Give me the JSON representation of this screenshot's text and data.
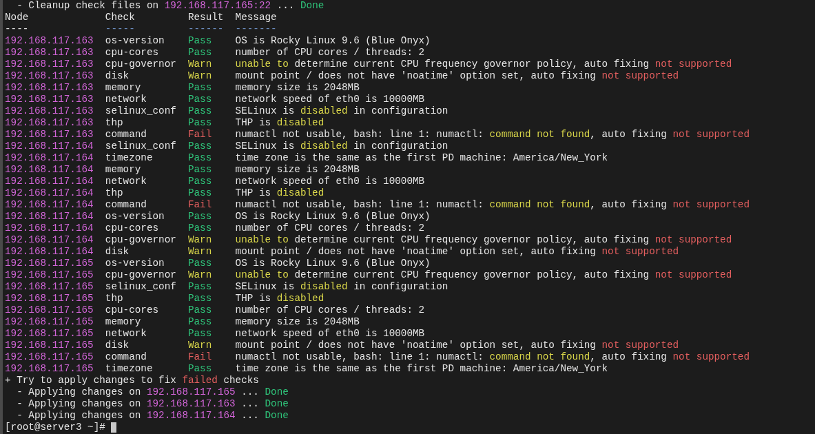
{
  "top_line": [
    {
      "text": "  - Cleanup check files on ",
      "kind": "plain"
    },
    {
      "text": "192.168.117.165:22",
      "kind": "host"
    },
    {
      "text": " ... ",
      "kind": "plain"
    },
    {
      "text": "Done",
      "kind": "ok"
    }
  ],
  "columns": [
    "Node",
    "Check",
    "Result",
    "Message"
  ],
  "column_rules": [
    {
      "text": "----",
      "kind": "plain"
    },
    {
      "text": "-----",
      "kind": "rule"
    },
    {
      "text": "------",
      "kind": "rule"
    },
    {
      "text": "-------",
      "kind": "rule"
    }
  ],
  "rows": [
    {
      "node": "192.168.117.163",
      "check": "os-version",
      "result": "Pass",
      "kind": "pass",
      "message": [
        {
          "text": "OS is Rocky Linux 9.6 (Blue Onyx)",
          "kind": "plain"
        }
      ]
    },
    {
      "node": "192.168.117.163",
      "check": "cpu-cores",
      "result": "Pass",
      "kind": "pass",
      "message": [
        {
          "text": "number of CPU cores / threads: 2",
          "kind": "plain"
        }
      ]
    },
    {
      "node": "192.168.117.163",
      "check": "cpu-governor",
      "result": "Warn",
      "kind": "warn",
      "message": [
        {
          "text": "unable to",
          "kind": "warn"
        },
        {
          "text": " determine current CPU frequency governor policy, auto fixing ",
          "kind": "plain"
        },
        {
          "text": "not supported",
          "kind": "fail"
        }
      ]
    },
    {
      "node": "192.168.117.163",
      "check": "disk",
      "result": "Warn",
      "kind": "warn",
      "message": [
        {
          "text": "mount point / does not have 'noatime' option set, auto fixing ",
          "kind": "plain"
        },
        {
          "text": "not supported",
          "kind": "fail"
        }
      ]
    },
    {
      "node": "192.168.117.163",
      "check": "memory",
      "result": "Pass",
      "kind": "pass",
      "message": [
        {
          "text": "memory size is 2048MB",
          "kind": "plain"
        }
      ]
    },
    {
      "node": "192.168.117.163",
      "check": "network",
      "result": "Pass",
      "kind": "pass",
      "message": [
        {
          "text": "network speed of eth0 is 10000MB",
          "kind": "plain"
        }
      ]
    },
    {
      "node": "192.168.117.163",
      "check": "selinux_conf",
      "result": "Pass",
      "kind": "pass",
      "message": [
        {
          "text": "SELinux is ",
          "kind": "plain"
        },
        {
          "text": "disabled",
          "kind": "warn"
        },
        {
          "text": " in configuration",
          "kind": "plain"
        }
      ]
    },
    {
      "node": "192.168.117.163",
      "check": "thp",
      "result": "Pass",
      "kind": "pass",
      "message": [
        {
          "text": "THP is ",
          "kind": "plain"
        },
        {
          "text": "disabled",
          "kind": "warn"
        }
      ]
    },
    {
      "node": "192.168.117.163",
      "check": "command",
      "result": "Fail",
      "kind": "fail",
      "message": [
        {
          "text": "numactl not usable, bash: line 1: numactl: ",
          "kind": "plain"
        },
        {
          "text": "command not found",
          "kind": "warn"
        },
        {
          "text": ", auto fixing ",
          "kind": "plain"
        },
        {
          "text": "not supported",
          "kind": "fail"
        }
      ]
    },
    {
      "node": "192.168.117.164",
      "check": "selinux_conf",
      "result": "Pass",
      "kind": "pass",
      "message": [
        {
          "text": "SELinux is ",
          "kind": "plain"
        },
        {
          "text": "disabled",
          "kind": "warn"
        },
        {
          "text": " in configuration",
          "kind": "plain"
        }
      ]
    },
    {
      "node": "192.168.117.164",
      "check": "timezone",
      "result": "Pass",
      "kind": "pass",
      "message": [
        {
          "text": "time zone is the same as the first PD machine: America/New_York",
          "kind": "plain"
        }
      ]
    },
    {
      "node": "192.168.117.164",
      "check": "memory",
      "result": "Pass",
      "kind": "pass",
      "message": [
        {
          "text": "memory size is 2048MB",
          "kind": "plain"
        }
      ]
    },
    {
      "node": "192.168.117.164",
      "check": "network",
      "result": "Pass",
      "kind": "pass",
      "message": [
        {
          "text": "network speed of eth0 is 10000MB",
          "kind": "plain"
        }
      ]
    },
    {
      "node": "192.168.117.164",
      "check": "thp",
      "result": "Pass",
      "kind": "pass",
      "message": [
        {
          "text": "THP is ",
          "kind": "plain"
        },
        {
          "text": "disabled",
          "kind": "warn"
        }
      ]
    },
    {
      "node": "192.168.117.164",
      "check": "command",
      "result": "Fail",
      "kind": "fail",
      "message": [
        {
          "text": "numactl not usable, bash: line 1: numactl: ",
          "kind": "plain"
        },
        {
          "text": "command not found",
          "kind": "warn"
        },
        {
          "text": ", auto fixing ",
          "kind": "plain"
        },
        {
          "text": "not supported",
          "kind": "fail"
        }
      ]
    },
    {
      "node": "192.168.117.164",
      "check": "os-version",
      "result": "Pass",
      "kind": "pass",
      "message": [
        {
          "text": "OS is Rocky Linux 9.6 (Blue Onyx)",
          "kind": "plain"
        }
      ]
    },
    {
      "node": "192.168.117.164",
      "check": "cpu-cores",
      "result": "Pass",
      "kind": "pass",
      "message": [
        {
          "text": "number of CPU cores / threads: 2",
          "kind": "plain"
        }
      ]
    },
    {
      "node": "192.168.117.164",
      "check": "cpu-governor",
      "result": "Warn",
      "kind": "warn",
      "message": [
        {
          "text": "unable to",
          "kind": "warn"
        },
        {
          "text": " determine current CPU frequency governor policy, auto fixing ",
          "kind": "plain"
        },
        {
          "text": "not supported",
          "kind": "fail"
        }
      ]
    },
    {
      "node": "192.168.117.164",
      "check": "disk",
      "result": "Warn",
      "kind": "warn",
      "message": [
        {
          "text": "mount point / does not have 'noatime' option set, auto fixing ",
          "kind": "plain"
        },
        {
          "text": "not supported",
          "kind": "fail"
        }
      ]
    },
    {
      "node": "192.168.117.165",
      "check": "os-version",
      "result": "Pass",
      "kind": "pass",
      "message": [
        {
          "text": "OS is Rocky Linux 9.6 (Blue Onyx)",
          "kind": "plain"
        }
      ]
    },
    {
      "node": "192.168.117.165",
      "check": "cpu-governor",
      "result": "Warn",
      "kind": "warn",
      "message": [
        {
          "text": "unable to",
          "kind": "warn"
        },
        {
          "text": " determine current CPU frequency governor policy, auto fixing ",
          "kind": "plain"
        },
        {
          "text": "not supported",
          "kind": "fail"
        }
      ]
    },
    {
      "node": "192.168.117.165",
      "check": "selinux_conf",
      "result": "Pass",
      "kind": "pass",
      "message": [
        {
          "text": "SELinux is ",
          "kind": "plain"
        },
        {
          "text": "disabled",
          "kind": "warn"
        },
        {
          "text": " in configuration",
          "kind": "plain"
        }
      ]
    },
    {
      "node": "192.168.117.165",
      "check": "thp",
      "result": "Pass",
      "kind": "pass",
      "message": [
        {
          "text": "THP is ",
          "kind": "plain"
        },
        {
          "text": "disabled",
          "kind": "warn"
        }
      ]
    },
    {
      "node": "192.168.117.165",
      "check": "cpu-cores",
      "result": "Pass",
      "kind": "pass",
      "message": [
        {
          "text": "number of CPU cores / threads: 2",
          "kind": "plain"
        }
      ]
    },
    {
      "node": "192.168.117.165",
      "check": "memory",
      "result": "Pass",
      "kind": "pass",
      "message": [
        {
          "text": "memory size is 2048MB",
          "kind": "plain"
        }
      ]
    },
    {
      "node": "192.168.117.165",
      "check": "network",
      "result": "Pass",
      "kind": "pass",
      "message": [
        {
          "text": "network speed of eth0 is 10000MB",
          "kind": "plain"
        }
      ]
    },
    {
      "node": "192.168.117.165",
      "check": "disk",
      "result": "Warn",
      "kind": "warn",
      "message": [
        {
          "text": "mount point / does not have 'noatime' option set, auto fixing ",
          "kind": "plain"
        },
        {
          "text": "not supported",
          "kind": "fail"
        }
      ]
    },
    {
      "node": "192.168.117.165",
      "check": "command",
      "result": "Fail",
      "kind": "fail",
      "message": [
        {
          "text": "numactl not usable, bash: line 1: numactl: ",
          "kind": "plain"
        },
        {
          "text": "command not found",
          "kind": "warn"
        },
        {
          "text": ", auto fixing ",
          "kind": "plain"
        },
        {
          "text": "not supported",
          "kind": "fail"
        }
      ]
    },
    {
      "node": "192.168.117.165",
      "check": "timezone",
      "result": "Pass",
      "kind": "pass",
      "message": [
        {
          "text": "time zone is the same as the first PD machine: America/New_York",
          "kind": "plain"
        }
      ]
    }
  ],
  "footer_lines": [
    [
      {
        "text": "+ Try to apply changes to fix ",
        "kind": "plain"
      },
      {
        "text": "failed",
        "kind": "fail"
      },
      {
        "text": " checks",
        "kind": "plain"
      }
    ],
    [
      {
        "text": "  - Applying changes on ",
        "kind": "plain"
      },
      {
        "text": "192.168.117.165",
        "kind": "host"
      },
      {
        "text": " ... ",
        "kind": "plain"
      },
      {
        "text": "Done",
        "kind": "ok"
      }
    ],
    [
      {
        "text": "  - Applying changes on ",
        "kind": "plain"
      },
      {
        "text": "192.168.117.163",
        "kind": "host"
      },
      {
        "text": " ... ",
        "kind": "plain"
      },
      {
        "text": "Done",
        "kind": "ok"
      }
    ],
    [
      {
        "text": "  - Applying changes on ",
        "kind": "plain"
      },
      {
        "text": "192.168.117.164",
        "kind": "host"
      },
      {
        "text": " ... ",
        "kind": "plain"
      },
      {
        "text": "Done",
        "kind": "ok"
      }
    ]
  ],
  "prompt": {
    "text": "[root@server3 ~]#",
    "cursor": true
  }
}
